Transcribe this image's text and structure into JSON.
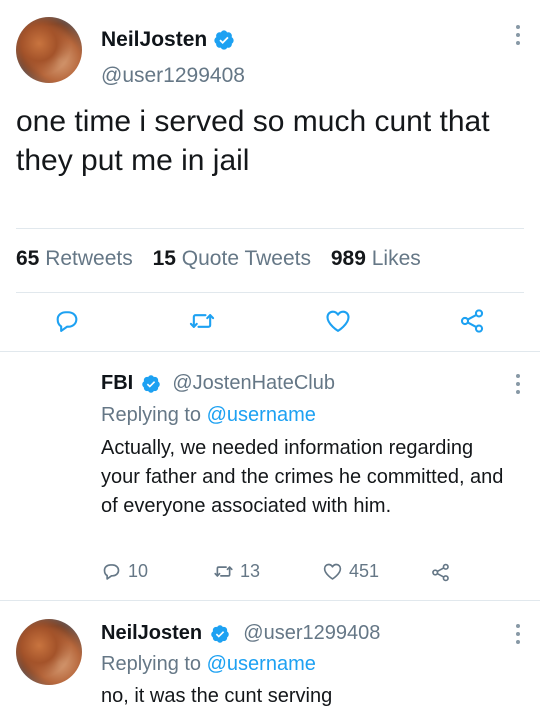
{
  "main_tweet": {
    "display_name": "NeilJosten",
    "handle": "@user1299408",
    "text": "one time i served so much cunt that they put me in jail",
    "stats": {
      "retweets_count": "65",
      "retweets_label": "Retweets",
      "quotes_count": "15",
      "quotes_label": "Quote Tweets",
      "likes_count": "989",
      "likes_label": "Likes"
    },
    "actions": [
      "reply-icon",
      "retweet-icon",
      "like-icon",
      "share-icon"
    ]
  },
  "reply_1": {
    "display_name": "FBI",
    "handle": "@JostenHateClub",
    "replying_prefix": "Replying to",
    "replying_to": "@username",
    "text": "Actually, we needed information regarding your father and the crimes he committed, and of everyone associated with him.",
    "reply_count": "10",
    "retweet_count": "13",
    "like_count": "451"
  },
  "reply_2": {
    "display_name": "NeilJosten",
    "handle": "@user1299408",
    "replying_prefix": "Replying to",
    "replying_to": "@username",
    "text": "no, it was the cunt serving"
  },
  "colors": {
    "accent": "#1da1f2",
    "secondary_text": "#657786",
    "divider": "#e1e8ed"
  }
}
